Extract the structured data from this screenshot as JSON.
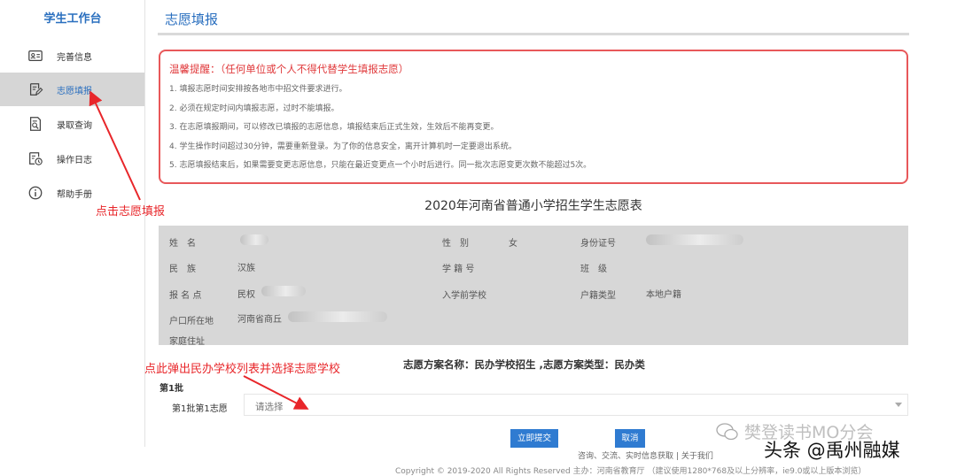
{
  "sidebar": {
    "title": "学生工作台",
    "items": [
      {
        "label": "完善信息",
        "icon": "id-card-icon"
      },
      {
        "label": "志愿填报",
        "icon": "form-edit-icon",
        "active": true
      },
      {
        "label": "录取查询",
        "icon": "document-search-icon"
      },
      {
        "label": "操作日志",
        "icon": "log-clock-icon"
      },
      {
        "label": "帮助手册",
        "icon": "info-circle-icon"
      }
    ]
  },
  "header": {
    "title": "志愿填报"
  },
  "notice": {
    "title": "温馨提醒：（任何单位或个人不得代替学生填报志愿）",
    "lines": [
      "1. 填报志愿时间安排按各地市中招文件要求进行。",
      "2. 必须在规定时间内填报志愿，过时不能填报。",
      "3. 在志愿填报期间，可以修改已填报的志愿信息，填报结束后正式生效，生效后不能再变更。",
      "4. 学生操作时间超过30分钟，需要重新登录。为了你的信息安全，离开计算机时一定要退出系统。",
      "5. 志愿填报结束后，如果需要变更志愿信息，只能在最近变更点一个小时后进行。同一批次志愿变更次数不能超过5次。"
    ]
  },
  "form": {
    "title": "2020年河南省普通小学招生学生志愿表",
    "fields": {
      "name_label": "姓　名",
      "gender_label": "性　别",
      "gender_value": "女",
      "idcard_label": "身份证号",
      "ethnicity_label": "民　族",
      "ethnicity_value": "汉族",
      "student_no_label": "学 籍 号",
      "class_label": "班　级",
      "registration_label": "报 名 点",
      "registration_value": "民权",
      "prev_school_label": "入学前学校",
      "hukou_type_label": "户籍类型",
      "hukou_type_value": "本地户籍",
      "hukou_place_label": "户口所在地",
      "hukou_place_value": "河南省商丘",
      "address_label": "家庭住址"
    },
    "plan_name": "志愿方案名称：民办学校招生 ,志愿方案类型：民办类",
    "batch_label": "第1批",
    "choice_label": "第1批第1志愿",
    "select_placeholder": "请选择"
  },
  "buttons": {
    "submit": "立即提交",
    "cancel": "取消"
  },
  "footer": {
    "link1": "咨询、交流、实时信息获取",
    "separator": "|",
    "link2": "关于我们",
    "copyright": "Copyright © 2019-2020 All Rights Reserved 主办：河南省教育厅 （建议使用1280*768及以上分辨率，ie9.0或以上版本浏览）"
  },
  "annotations": {
    "sidebar_note": "点击志愿填报",
    "select_note": "点此弹出民办学校列表并选择志愿学校"
  },
  "watermarks": {
    "top": "樊登读书MO分会",
    "bottom": "头条 @禹州融媒"
  },
  "colors": {
    "accent": "#2a6fbf",
    "button": "#2f7bd1",
    "alert": "#e8585a",
    "annotation": "#e8262a"
  }
}
